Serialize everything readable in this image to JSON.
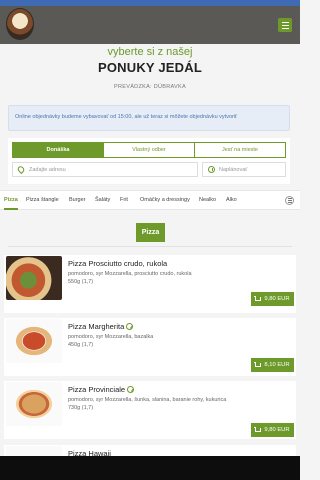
{
  "header": {
    "logo_icon": "restaurant-logo",
    "menu_icon": "hamburger-menu-icon"
  },
  "hero": {
    "subtitle": "vyberte si z našej",
    "title": "PONUKY JEDÁL",
    "branch": "PREVÁDZKA: DÚBRAVKA"
  },
  "info_message": "Online objednávky budeme vybavovať od 15:00, ale už teraz si môžete objednávku vytvoriť",
  "order": {
    "tabs": [
      {
        "label": "Donáška",
        "active": true
      },
      {
        "label": "Vlastný odber",
        "active": false
      },
      {
        "label": "Jesť na mieste",
        "active": false
      }
    ],
    "address_placeholder": "Zadajte adresu",
    "plan_placeholder": "Naplánovať"
  },
  "categories": [
    "Pizza",
    "Pizza štangle",
    "Burger",
    "Šaláty",
    "Frit",
    "Omáčky a dressingy",
    "Nealko",
    "Alko"
  ],
  "active_category": "Pizza",
  "section_title": "Pizza",
  "products": [
    {
      "name": "Pizza  Prosciutto crudo, rukola",
      "veg": false,
      "desc": "pomodoro, syr  Mozzarella, prosciutto crudo, rukola",
      "weight": "550g (1,7)",
      "price": "9,80 EUR"
    },
    {
      "name": "Pizza  Margherita",
      "veg": true,
      "desc": "pomodoro, syr  Mozzarella, bazalka",
      "weight": "450g (1,7)",
      "price": "8,10 EUR"
    },
    {
      "name": "Pizza  Provinciale",
      "veg": true,
      "desc": "pomodoro, syr  Mozzarella, šunka, slanina, baranie rohy, kukurica",
      "weight": "730g (1,7)",
      "price": "9,80 EUR"
    },
    {
      "name": "Pizza  Hawaii",
      "veg": false,
      "desc": "",
      "weight": "",
      "price": ""
    }
  ],
  "colors": {
    "accent": "#6d9a2a",
    "header": "#5b5956",
    "top_strip": "#3f6bb5",
    "info_bg": "#e6edf6"
  }
}
